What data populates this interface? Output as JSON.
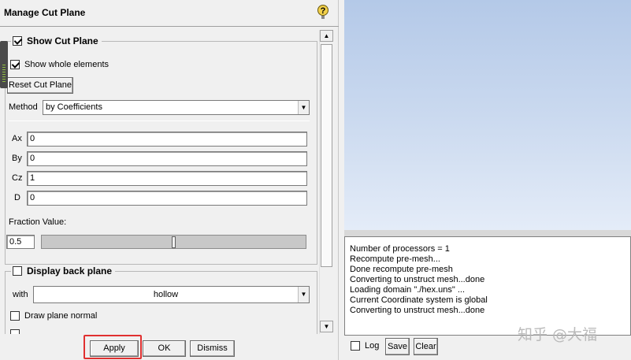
{
  "dialog": {
    "title": "Manage Cut Plane",
    "show_cut_plane": {
      "label": "Show Cut Plane",
      "checked": true
    },
    "show_whole_elements": {
      "label": "Show whole elements",
      "checked": true
    },
    "reset_button": "Reset Cut Plane",
    "method": {
      "label": "Method",
      "value": "by Coefficients"
    },
    "coefficients": [
      {
        "label": "Ax",
        "value": "0"
      },
      {
        "label": "By",
        "value": "0"
      },
      {
        "label": "Cz",
        "value": "1"
      },
      {
        "label": "D",
        "value": "0"
      }
    ],
    "fraction": {
      "label": "Fraction Value:",
      "value": "0.5",
      "slider_fraction": 0.5
    },
    "display_back_plane": {
      "label": "Display back plane",
      "checked": false
    },
    "with": {
      "label": "with",
      "value": "hollow"
    },
    "draw_plane_normal": {
      "label": "Draw plane normal",
      "checked": false
    },
    "buttons": {
      "apply": "Apply",
      "ok": "OK",
      "dismiss": "Dismiss"
    }
  },
  "log": {
    "lines": [
      "Number of processors = 1",
      "Recompute pre-mesh...",
      "Done recompute pre-mesh",
      "Converting to unstruct mesh...done",
      "Loading domain \"./hex.uns\" ...",
      "Current Coordinate system is global",
      "Converting to unstruct mesh...done"
    ],
    "log_checkbox": {
      "label": "Log",
      "checked": false
    },
    "save": "Save",
    "clear": "Clear"
  },
  "watermark": "知乎 @大福",
  "colors": {
    "highlight": "#e03030",
    "viewport_top": "#b4c9e8",
    "viewport_bottom": "#e4ecf8"
  }
}
